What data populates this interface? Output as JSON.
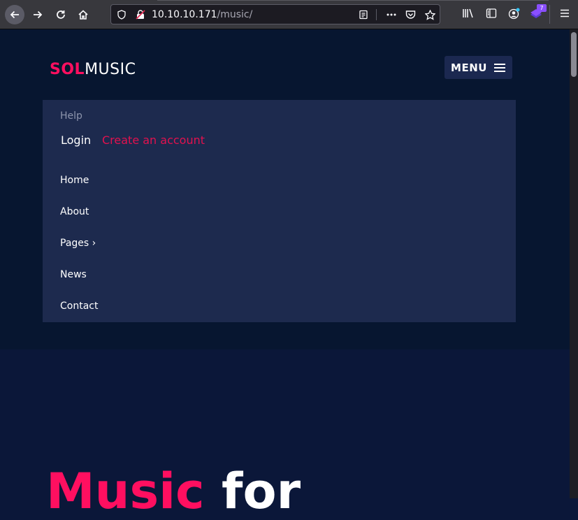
{
  "browser": {
    "url_host": "10.10.10.171",
    "url_path": "/music/",
    "extension_badge": "7"
  },
  "site": {
    "logo_part1": "SOL",
    "logo_part2": "MUSIC",
    "menu_label": "MENU",
    "help_label": "Help",
    "login_label": "Login",
    "create_account_label": "Create an account",
    "nav_items": [
      {
        "label": "Home"
      },
      {
        "label": "About"
      },
      {
        "label": "Pages ›"
      },
      {
        "label": "News"
      },
      {
        "label": "Contact"
      }
    ],
    "hero_word1": "Music",
    "hero_word2": " for"
  },
  "colors": {
    "accent": "#ff0f60",
    "header_bg": "#071630",
    "menu_panel_bg": "#1d2a4e",
    "hero_bg": "#0b1739"
  }
}
